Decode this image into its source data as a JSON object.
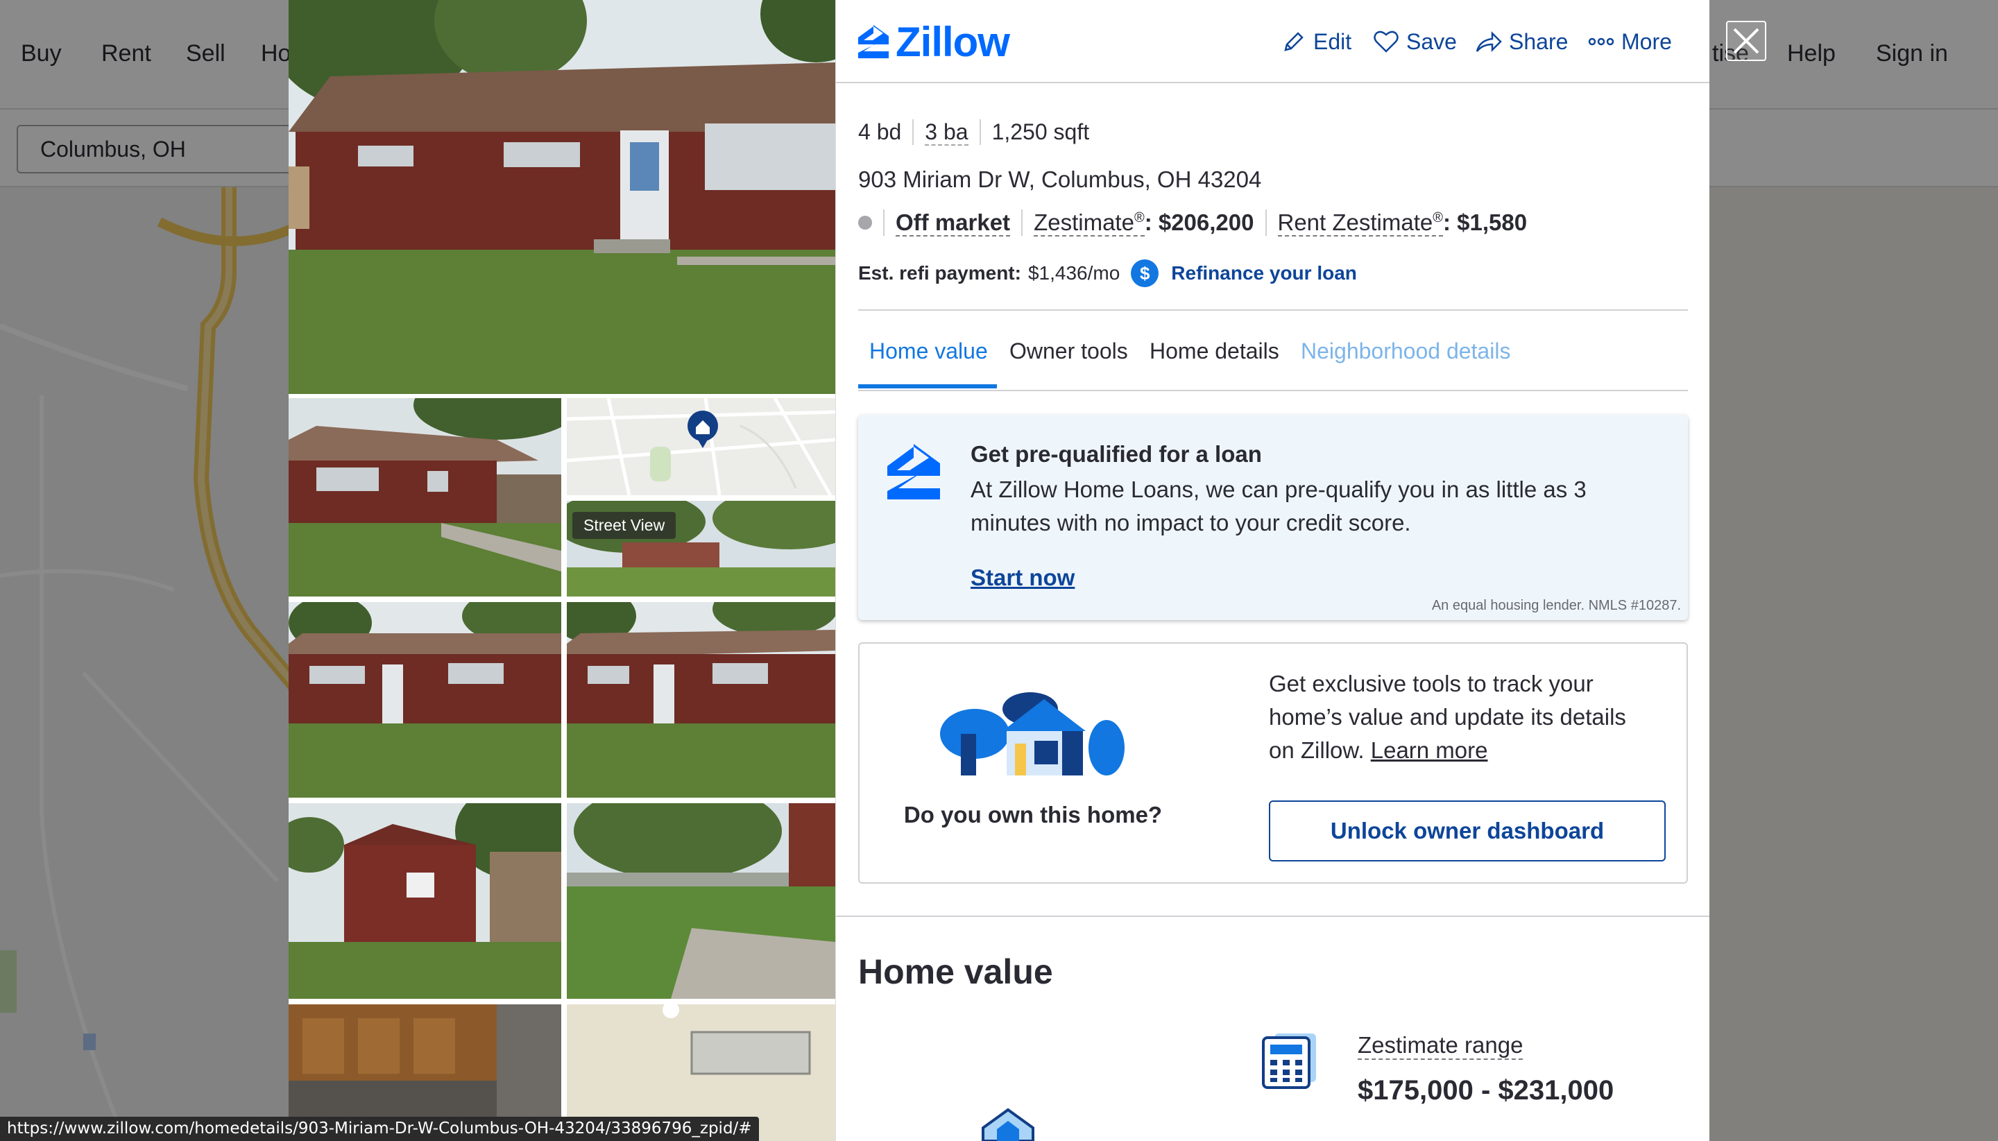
{
  "background_page": {
    "nav_left": [
      "Buy",
      "Rent",
      "Sell",
      "Ho"
    ],
    "nav_right": [
      "tise",
      "Help",
      "Sign in"
    ],
    "search_value": "Columbus, OH"
  },
  "gallery": {
    "street_view_label": "Street View"
  },
  "header": {
    "logo_text": "Zillow",
    "actions": [
      {
        "label": "Edit",
        "icon": "pencil-icon"
      },
      {
        "label": "Save",
        "icon": "heart-icon"
      },
      {
        "label": "Share",
        "icon": "share-icon"
      },
      {
        "label": "More",
        "icon": "more-dots-icon"
      }
    ]
  },
  "facts": {
    "beds": "4 bd",
    "baths": "3 ba",
    "sqft": "1,250 sqft"
  },
  "address": "903 Miriam Dr W, Columbus, OH 43204",
  "status": {
    "label": "Off market",
    "zestimate_label": "Zestimate",
    "zestimate_value": ": $206,200",
    "rent_label": "Rent Zestimate",
    "rent_value": ": $1,580",
    "registered": "®"
  },
  "refi": {
    "label": "Est. refi payment:",
    "value": "$1,436/mo",
    "icon_glyph": "$",
    "link": "Refinance your loan"
  },
  "tabs": [
    {
      "label": "Home value",
      "active": true
    },
    {
      "label": "Owner tools",
      "active": false
    },
    {
      "label": "Home details",
      "active": false
    },
    {
      "label": "Neighborhood details",
      "active": false
    }
  ],
  "prequal": {
    "title": "Get pre-qualified for a loan",
    "body": "At Zillow Home Loans, we can pre-qualify you in as little as 3 minutes with no impact to your credit score.",
    "cta": "Start now",
    "disclaimer": "An equal housing lender. NMLS #10287."
  },
  "owner": {
    "question": "Do you own this home?",
    "description": "Get exclusive tools to track your home’s value and update its details on Zillow.",
    "learn_more": "Learn more",
    "button": "Unlock owner dashboard"
  },
  "home_value": {
    "heading": "Home value",
    "range_label": "Zestimate range",
    "range_value": "$175,000 - $231,000"
  },
  "status_bar_url": "https://www.zillow.com/homedetails/903-Miriam-Dr-W-Columbus-OH-43204/33896796_zpid/#",
  "colors": {
    "brand_blue": "#006aff",
    "link_blue": "#0d4599",
    "tab_active": "#1277e1"
  }
}
